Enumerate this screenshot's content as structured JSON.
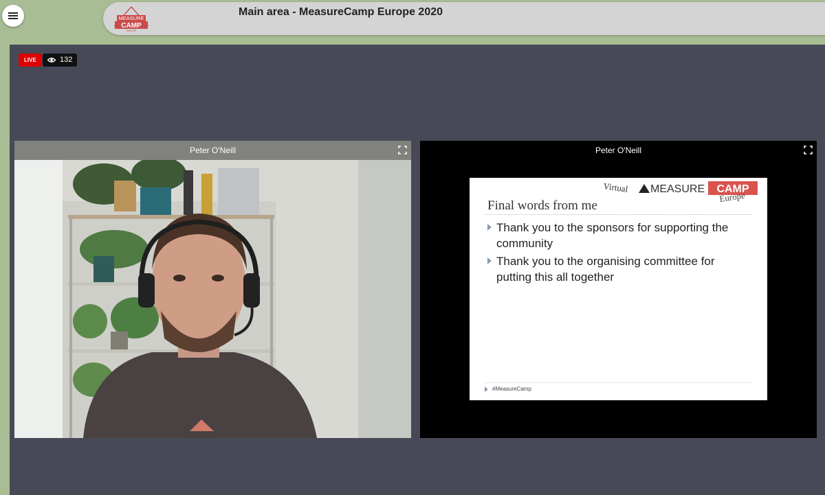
{
  "header": {
    "title": "Main area - MeasureCamp Europe 2020",
    "logo": {
      "top_text": "MEASURE",
      "bottom_text": "CAMP",
      "sub_text": "EUROPE",
      "color": "#c94b4b"
    }
  },
  "stream": {
    "live_label": "LIVE",
    "viewer_count": "132"
  },
  "tiles": [
    {
      "name": "Peter O'Neill",
      "kind": "camera"
    },
    {
      "name": "Peter O'Neill",
      "kind": "screen-share"
    }
  ],
  "slide": {
    "brand_virtual": "Virtual",
    "brand_measure": "MEASURE",
    "brand_camp": "CAMP",
    "brand_europe": "Europe",
    "title": "Final words from me",
    "bullets": [
      "Thank you to the sponsors for supporting the community",
      "Thank you to the organising committee for putting this all together"
    ],
    "footer": "#MeasureCamp"
  },
  "colors": {
    "page_bg": "#a8bd94",
    "stage_bg": "#474a56",
    "live_red": "#e00000",
    "brand_red": "#d9534f"
  },
  "icons": [
    "menu-icon",
    "eye-icon",
    "expand-icon"
  ]
}
